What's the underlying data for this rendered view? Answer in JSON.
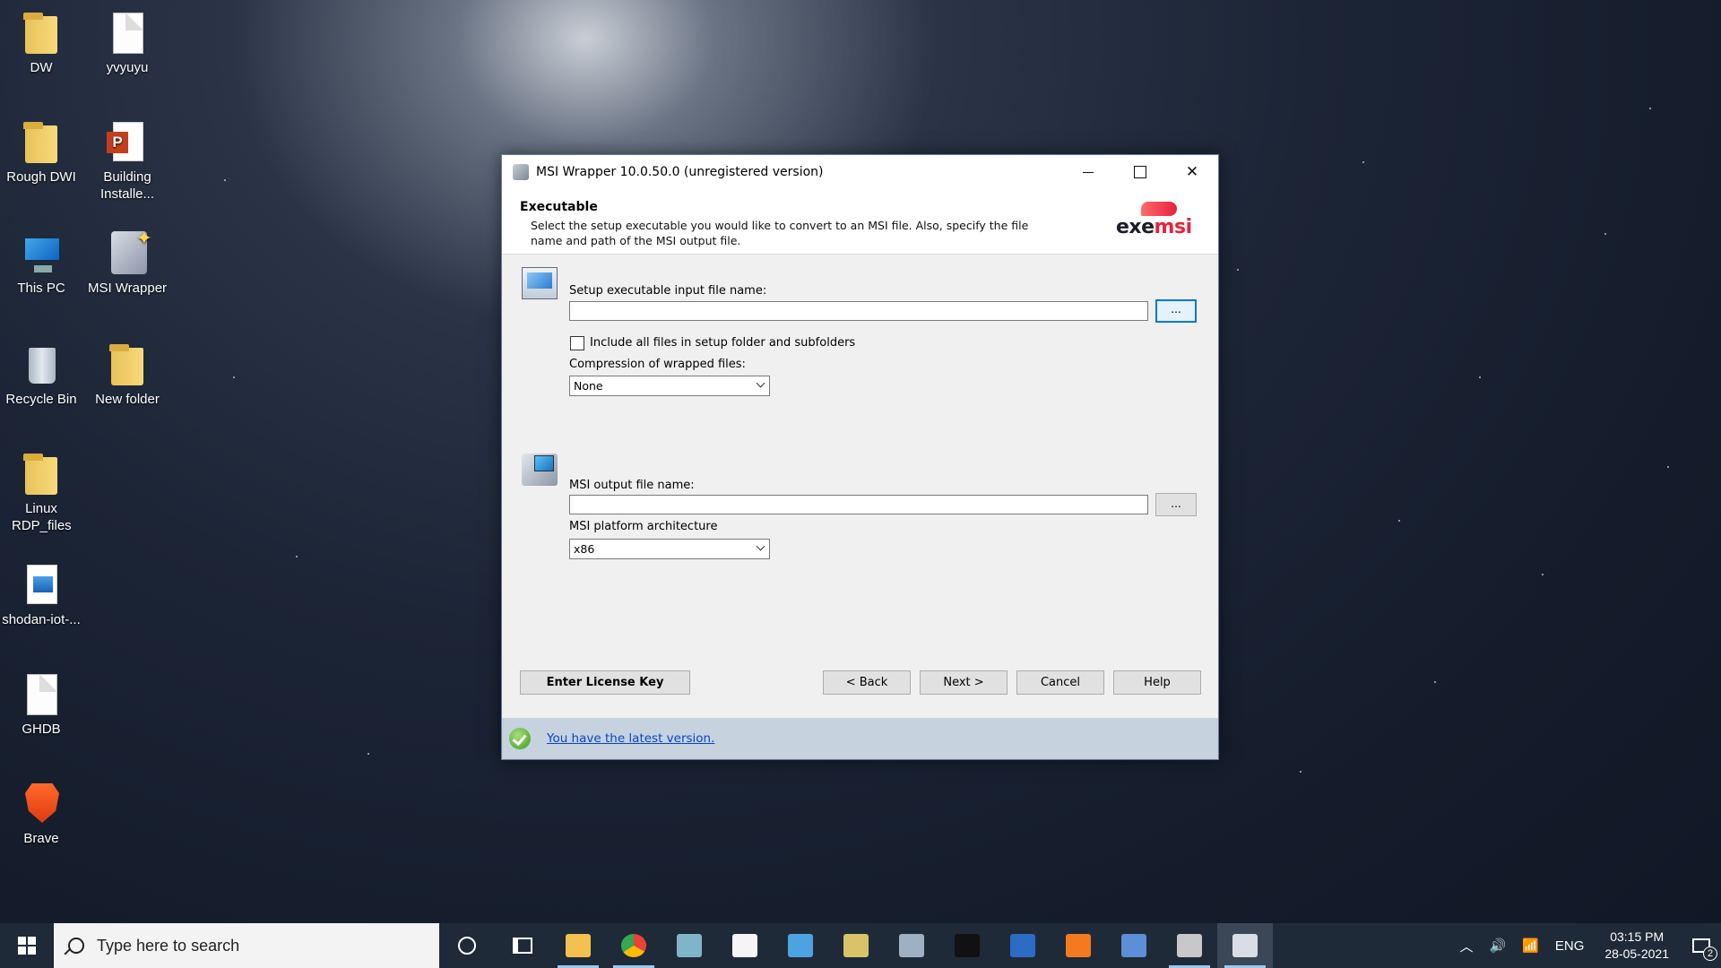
{
  "desktop": {
    "icons": [
      {
        "label": "DW",
        "icon": "folder-icon"
      },
      {
        "label": "yvyuyu",
        "icon": "document-icon"
      },
      {
        "label": "Rough DWI",
        "icon": "folder-icon"
      },
      {
        "label": "Building Installe...",
        "icon": "powerpoint-icon"
      },
      {
        "label": "This PC",
        "icon": "computer-icon"
      },
      {
        "label": "MSI Wrapper",
        "icon": "msi-wrapper-icon"
      },
      {
        "label": "Recycle Bin",
        "icon": "recycle-bin-icon"
      },
      {
        "label": "New folder",
        "icon": "folder-icon"
      },
      {
        "label": "Linux RDP_files",
        "icon": "folder-icon"
      },
      {
        "label": "shodan-iot-...",
        "icon": "image-icon"
      },
      {
        "label": "GHDB",
        "icon": "document-icon"
      },
      {
        "label": "Brave",
        "icon": "brave-icon"
      }
    ]
  },
  "window": {
    "title": "MSI Wrapper 10.0.50.0 (unregistered version)",
    "header": {
      "title": "Executable",
      "description": "Select the setup executable you would like to convert to an MSI file. Also, specify the file name and path of the MSI output file.",
      "logo_exe": "exe",
      "logo_msi": "msi"
    },
    "setup_input": {
      "label": "Setup executable input file name:",
      "value": "",
      "browse_label": "..."
    },
    "include_files": {
      "label": "Include all files in setup folder and subfolders",
      "checked": false
    },
    "compression": {
      "label": "Compression of wrapped files:",
      "selected": "None"
    },
    "msi_output": {
      "label": "MSI output file name:",
      "value": "",
      "browse_label": "..."
    },
    "architecture": {
      "label": "MSI platform architecture",
      "selected": "x86"
    },
    "buttons": {
      "license": "Enter License Key",
      "back": "< Back",
      "next": "Next >",
      "cancel": "Cancel",
      "help": "Help"
    },
    "status": {
      "link": "You have the latest version."
    }
  },
  "taskbar": {
    "search_placeholder": "Type here to search",
    "language": "ENG",
    "time": "03:15 PM",
    "date": "28-05-2021",
    "notification_count": "2",
    "apps": [
      {
        "name": "file-explorer-icon",
        "color": "#f2c14e"
      },
      {
        "name": "chrome-icon",
        "color": "#e94235"
      },
      {
        "name": "app-cube-icon",
        "color": "#7fb5c9"
      },
      {
        "name": "document-icon",
        "color": "#f5f5f5"
      },
      {
        "name": "control-panel-icon",
        "color": "#4da3e0"
      },
      {
        "name": "python-icon",
        "color": "#d9c36a"
      },
      {
        "name": "performance-monitor-icon",
        "color": "#9fb0c4"
      },
      {
        "name": "terminal-icon",
        "color": "#111111"
      },
      {
        "name": "powershell-icon",
        "color": "#2b6cc4"
      },
      {
        "name": "xampp-icon",
        "color": "#f47a20"
      },
      {
        "name": "virtualbox-icon",
        "color": "#5c8fd6"
      },
      {
        "name": "settings-icon",
        "color": "#c8c8c8"
      },
      {
        "name": "msi-wrapper-icon",
        "color": "#d8dde6"
      }
    ]
  }
}
